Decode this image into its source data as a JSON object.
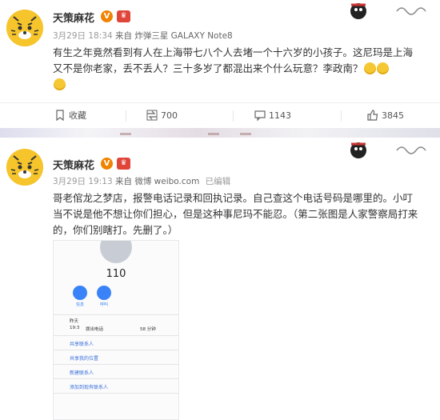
{
  "post1": {
    "username": "天策麻花",
    "verified_badge": "V",
    "level_badge": "♛",
    "date": "3月29日 18:34",
    "source": "来自 炸弹三星 GALAXY Note8",
    "text": "有生之年竟然看到有人在上海带七八个人去堵一个十六岁的小孩子。这尼玛是上海又不是你老家，丢不丢人？三十多岁了都混出来个什么玩意？李政南？",
    "actions": {
      "favorite": "收藏",
      "share": "700",
      "comment": "1143",
      "like": "3845"
    }
  },
  "post2": {
    "username": "天策麻花",
    "verified_badge": "V",
    "level_badge": "♛",
    "date": "3月29日 19:13",
    "source": "来自 微博 weibo.com",
    "edited": "已编辑",
    "text": "哥老倌龙之梦店，报警电话记录和回执记录。自己查这个电话号码是哪里的。小叮当不说是他不想让你们担心，但是这种事尼玛不能忍。（第二张图是人家警察局打来的，你们别瞎打。先删了。）",
    "phone": {
      "number": "110",
      "btn1": "信息",
      "btn2": "呼叫",
      "btn3": "视频",
      "day": "昨天",
      "time": "19:3",
      "call_type": "拨出电话",
      "duration": "58 分钟",
      "links": [
        "共享联系人",
        "共享我的位置",
        "新建联系人",
        "添加到现有联系人"
      ]
    }
  },
  "icons": {
    "favorite": "bookmark-icon",
    "share": "share-icon",
    "comment": "comment-icon",
    "like": "thumbs-up-icon"
  },
  "colors": {
    "accent": "#f08300",
    "link": "#3a6fd8",
    "avatar": "#f6c42b"
  }
}
